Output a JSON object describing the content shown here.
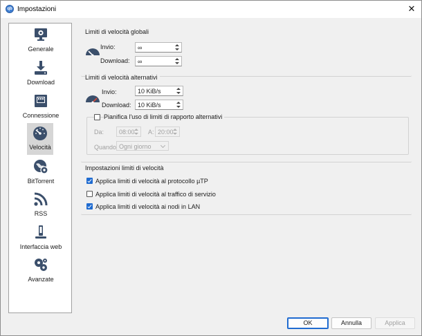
{
  "window": {
    "title": "Impostazioni",
    "app_icon_text": "qb"
  },
  "sidebar": {
    "items": [
      {
        "label": "Generale",
        "icon": "monitor-gear-icon"
      },
      {
        "label": "Download",
        "icon": "download-icon"
      },
      {
        "label": "Connessione",
        "icon": "network-icon"
      },
      {
        "label": "Velocità",
        "icon": "speedometer-icon"
      },
      {
        "label": "BitTorrent",
        "icon": "globe-gear-icon"
      },
      {
        "label": "RSS",
        "icon": "rss-icon"
      },
      {
        "label": "Interfaccia web",
        "icon": "web-ui-icon"
      },
      {
        "label": "Avanzate",
        "icon": "gears-icon"
      }
    ],
    "selected": "Velocità"
  },
  "global_limits": {
    "title": "Limiti di velocità globali",
    "upload_label": "Invio:",
    "upload_value": "∞",
    "download_label": "Download:",
    "download_value": "∞"
  },
  "alt_limits": {
    "title": "Limiti di velocità alternativi",
    "upload_label": "Invio:",
    "upload_value": "10 KiB/s",
    "download_label": "Download:",
    "download_value": "10 KiB/s",
    "schedule": {
      "checkbox_label": "Pianifica l'uso di limiti di rapporto alternativi",
      "checked": false,
      "from_label": "Da:",
      "from_value": "08:00",
      "to_label": "A:",
      "to_value": "20:00",
      "when_label": "Quando:",
      "when_value": "Ogni giorno"
    }
  },
  "settings": {
    "title": "Impostazioni limiti di velocità",
    "options": [
      {
        "label": "Applica limiti di velocità al protocollo µTP",
        "checked": true
      },
      {
        "label": "Applica limiti di velocità al traffico di servizio",
        "checked": false
      },
      {
        "label": "Applica limiti di velocità ai nodi in LAN",
        "checked": true
      }
    ]
  },
  "footer": {
    "ok_label": "OK",
    "cancel_label": "Annulla",
    "apply_label": "Applica"
  },
  "colors": {
    "accent": "#1f6bd0",
    "gauge": "#3b4f6b",
    "gauge_alt_needle": "#d04a3a"
  }
}
